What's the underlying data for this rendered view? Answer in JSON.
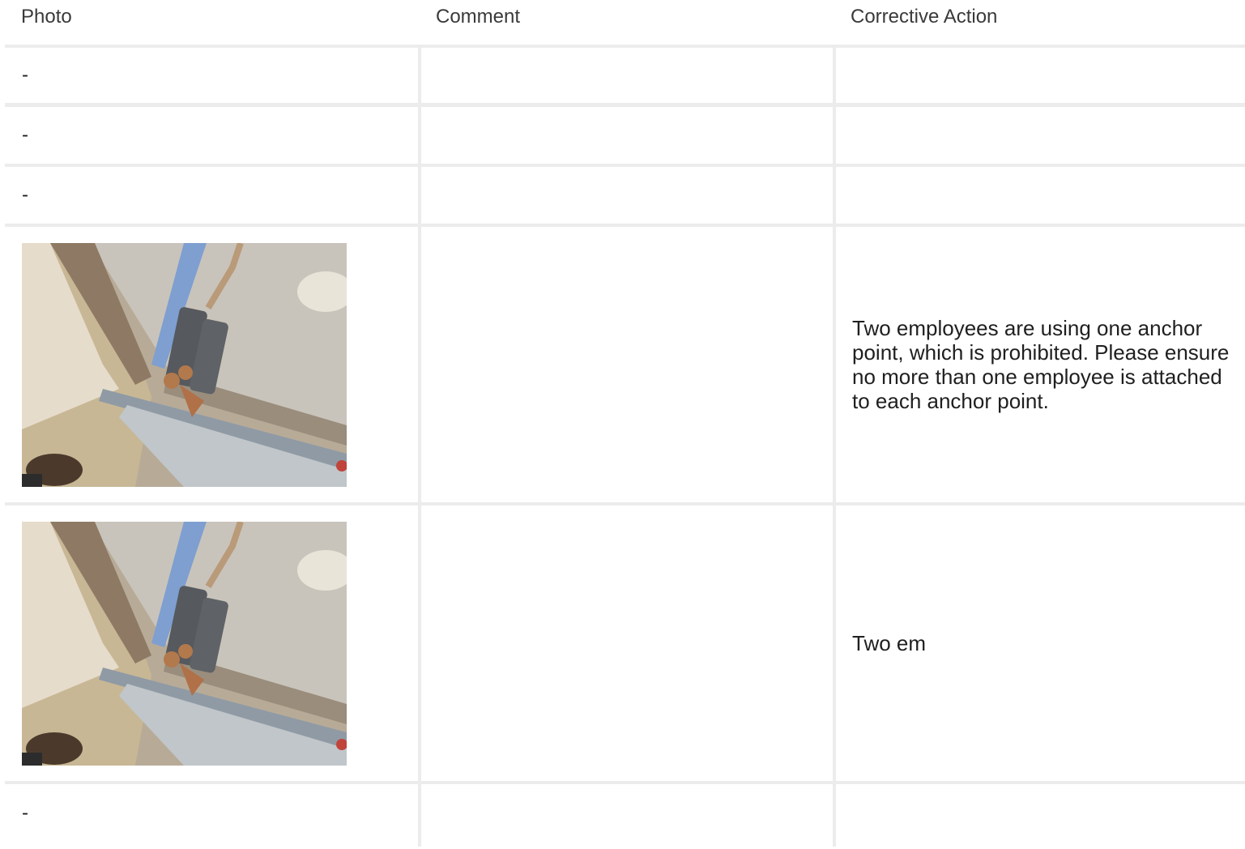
{
  "columns": {
    "photo": "Photo",
    "comment": "Comment",
    "corrective_action": "Corrective Action"
  },
  "rows": [
    {
      "photo": "-",
      "comment": "",
      "corrective_action": ""
    },
    {
      "photo": "-",
      "comment": "",
      "corrective_action": ""
    },
    {
      "photo": "-",
      "comment": "",
      "corrective_action": ""
    },
    {
      "photo_image": "photo-thumbnail",
      "comment": "",
      "corrective_action": "Two employees are using one anchor point, which is prohibited. Please ensure no more than one employee is attached to each anchor point."
    },
    {
      "photo_image": "photo-thumbnail",
      "comment": "",
      "corrective_action": "Two em"
    },
    {
      "photo": "-",
      "comment": "",
      "corrective_action": ""
    }
  ]
}
